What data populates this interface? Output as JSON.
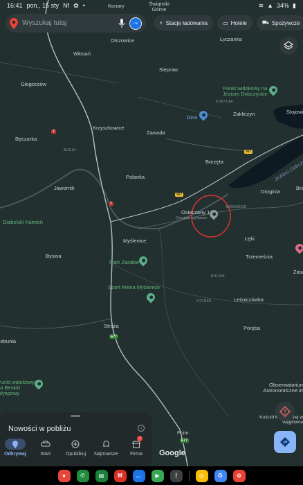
{
  "status_bar": {
    "time": "16:41",
    "date": "pon., 15 sty",
    "left_icons": [
      "nfc-icon",
      "dot"
    ],
    "battery": "34%"
  },
  "search": {
    "placeholder": "Wyszukaj tutaj",
    "avatar_text": "LTE"
  },
  "chips": [
    {
      "icon": "ev-charger-icon",
      "label": "Stacje ładowania"
    },
    {
      "icon": "bed-icon",
      "label": "Hotele"
    },
    {
      "icon": "cart-icon",
      "label": "Spożywcze"
    }
  ],
  "map": {
    "places": [
      {
        "name": "Konary"
      },
      {
        "name": "Świątniki Górne"
      },
      {
        "name": "Olszowice"
      },
      {
        "name": "Łyczanka"
      },
      {
        "name": "Włosań"
      },
      {
        "name": "Siepraw"
      },
      {
        "name": "Głogoczów"
      },
      {
        "name": "Punkt widokowy na Jezioro Dobczyckie"
      },
      {
        "name": "KOBYLAK"
      },
      {
        "name": "Zakliczyn"
      },
      {
        "name": "Stojowi"
      },
      {
        "name": "Dino"
      },
      {
        "name": "Krzyszkowice"
      },
      {
        "name": "Zawada"
      },
      {
        "name": "Bęczarka"
      },
      {
        "name": "BUGAJ"
      },
      {
        "name": "Borzęta"
      },
      {
        "name": "Polanka"
      },
      {
        "name": "Jezioro Dobczyckie"
      },
      {
        "name": "Jawornik"
      },
      {
        "name": "Droginia"
      },
      {
        "name": "Braz"
      },
      {
        "name": "BANOWICE"
      },
      {
        "name": "Osieczany 1"
      },
      {
        "name": "Ostatnio oglądane"
      },
      {
        "name": "Diabelski Kamień"
      },
      {
        "name": "Myślenice"
      },
      {
        "name": "Łęki"
      },
      {
        "name": "Bysina"
      },
      {
        "name": "Park Zarabie"
      },
      {
        "name": "Trzemeśnia"
      },
      {
        "name": "Zasar"
      },
      {
        "name": "BULINA"
      },
      {
        "name": "Sport Arena Myślenice"
      },
      {
        "name": "STYREK"
      },
      {
        "name": "Leśniczówka"
      },
      {
        "name": "Stróża"
      },
      {
        "name": "Poręba"
      },
      {
        "name": "Trzebunia"
      },
      {
        "name": "Punkt widokowy na Beskid Wyspowy"
      },
      {
        "name": "Obserwatorium Astronomiczne im"
      },
      {
        "name": "Kościół Matki Bożej w Węglówce"
      },
      {
        "name": "Pcim"
      }
    ],
    "road_shields": [
      {
        "label": "7"
      },
      {
        "label": "967"
      },
      {
        "label": "967"
      },
      {
        "label": "7"
      },
      {
        "label": "E77"
      },
      {
        "label": "E77"
      }
    ],
    "google_logo": "Google"
  },
  "sheet": {
    "title": "Nowości w pobliżu"
  },
  "tabs": [
    {
      "label": "Odkrywaj",
      "icon": "location-pin-icon",
      "active": true
    },
    {
      "label": "Start",
      "icon": "car-icon",
      "active": false
    },
    {
      "label": "Opublikuj",
      "icon": "add-circle-icon",
      "active": false
    },
    {
      "label": "Najnowsze",
      "icon": "bell-icon",
      "active": false
    },
    {
      "label": "Firma",
      "icon": "store-icon",
      "active": false,
      "badge": "1"
    }
  ],
  "dock_apps": [
    {
      "name": "contacts-app",
      "color": "#e8453c",
      "glyph": "●"
    },
    {
      "name": "phone-app",
      "color": "#1e8e3e",
      "glyph": "✆"
    },
    {
      "name": "sheets-app",
      "color": "#188038",
      "glyph": "▤"
    },
    {
      "name": "gmail-app",
      "color": "#d93025",
      "glyph": "M"
    },
    {
      "name": "messages-app",
      "color": "#1a73e8",
      "glyph": "…"
    },
    {
      "name": "play-app",
      "color": "#34a853",
      "glyph": "▶"
    },
    {
      "name": "app-drawer",
      "color": "#3c4043",
      "glyph": "⋮"
    },
    {
      "name": "chrome-app",
      "color": "#fbbc04",
      "glyph": "◎"
    },
    {
      "name": "google-app",
      "color": "#4285f4",
      "glyph": "G"
    },
    {
      "name": "photos-app",
      "color": "#ea4335",
      "glyph": "✿"
    }
  ]
}
